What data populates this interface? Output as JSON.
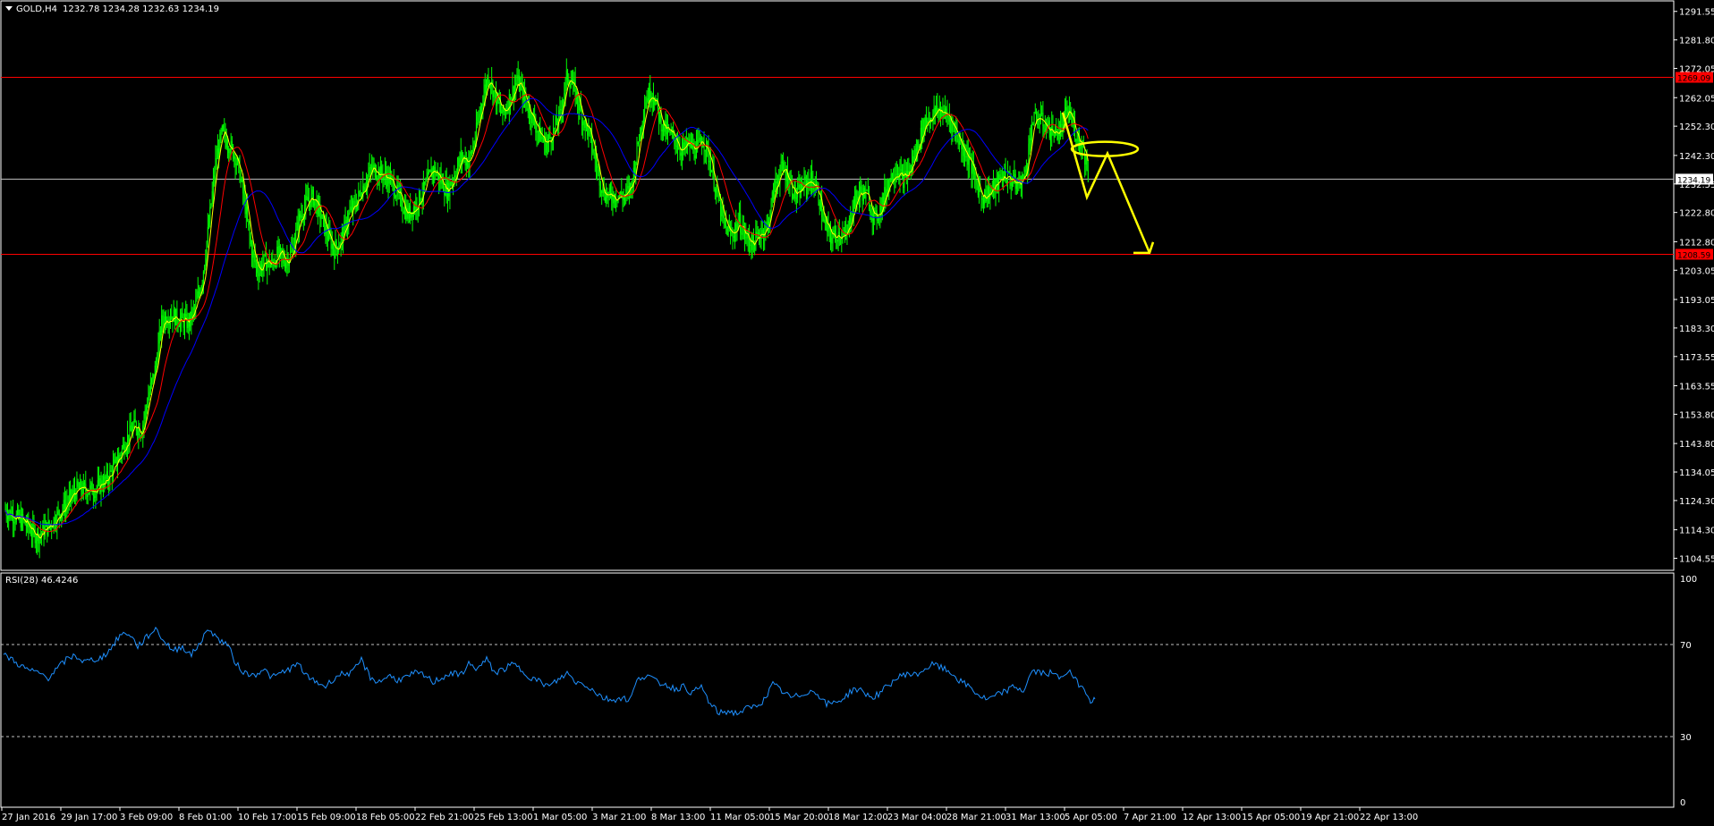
{
  "header": {
    "symbol_label": "GOLD,H4",
    "ohlc_label": "1232.78 1234.28 1232.63 1234.19"
  },
  "rsi_panel": {
    "label": "RSI(28) 46.4246",
    "levels": [
      "100",
      "70",
      "30",
      "0"
    ]
  },
  "colors": {
    "background": "#000000",
    "candles": "#00ff00",
    "ma_fast": "#ffff00",
    "ma_mid": "#ff0000",
    "ma_slow": "#0000ff",
    "horizontal_levels": "#ff0000",
    "current_price_line": "#c0c0c0",
    "rsi_line": "#1e90ff",
    "annotation": "#ffff00",
    "axis_text": "#ffffff"
  },
  "chart_data": [
    {
      "type": "candlestick",
      "title": "",
      "xlabel": "",
      "ylabel": "",
      "ylim": [
        1101.35,
        1293.0
      ],
      "grid": false,
      "y_ticks": [
        "1291.55",
        "1281.80",
        "1272.05",
        "1262.05",
        "1252.30",
        "1242.30",
        "1232.55",
        "1222.80",
        "1212.80",
        "1203.05",
        "1193.05",
        "1183.30",
        "1173.55",
        "1163.55",
        "1153.80",
        "1143.80",
        "1134.05",
        "1124.30",
        "1114.30",
        "1104.55"
      ],
      "x_ticks": [
        "27 Jan 2016",
        "29 Jan 17:00",
        "3 Feb 09:00",
        "8 Feb 01:00",
        "10 Feb 17:00",
        "15 Feb 09:00",
        "18 Feb 05:00",
        "22 Feb 21:00",
        "25 Feb 13:00",
        "1 Mar 05:00",
        "3 Mar 21:00",
        "8 Mar 13:00",
        "11 Mar 05:00",
        "15 Mar 20:00",
        "18 Mar 12:00",
        "23 Mar 04:00",
        "28 Mar 21:00",
        "31 Mar 13:00",
        "5 Apr 05:00",
        "7 Apr 21:00",
        "12 Apr 13:00",
        "15 Apr 05:00",
        "19 Apr 21:00",
        "22 Apr 13:00"
      ],
      "horizontal_lines": [
        {
          "value": 1269.0,
          "label": "1269.09",
          "color": "#ff0000"
        },
        {
          "value": 1234.19,
          "label": "1234.19",
          "color": "#c0c0c0"
        },
        {
          "value": 1208.5,
          "label": "1208.59",
          "color": "#ff0000"
        }
      ],
      "price_path": [
        [
          0,
          1121
        ],
        [
          20,
          1117
        ],
        [
          35,
          1112
        ],
        [
          50,
          1116
        ],
        [
          65,
          1122
        ],
        [
          80,
          1128
        ],
        [
          100,
          1128
        ],
        [
          115,
          1132
        ],
        [
          125,
          1138
        ],
        [
          135,
          1145
        ],
        [
          145,
          1150
        ],
        [
          152,
          1148
        ],
        [
          160,
          1160
        ],
        [
          168,
          1170
        ],
        [
          175,
          1186
        ],
        [
          185,
          1188
        ],
        [
          195,
          1186
        ],
        [
          205,
          1185
        ],
        [
          212,
          1190
        ],
        [
          220,
          1200
        ],
        [
          228,
          1220
        ],
        [
          235,
          1240
        ],
        [
          242,
          1250
        ],
        [
          250,
          1246
        ],
        [
          257,
          1242
        ],
        [
          262,
          1236
        ],
        [
          268,
          1225
        ],
        [
          275,
          1210
        ],
        [
          282,
          1203
        ],
        [
          290,
          1206
        ],
        [
          298,
          1205
        ],
        [
          305,
          1209
        ],
        [
          312,
          1206
        ],
        [
          320,
          1209
        ],
        [
          328,
          1220
        ],
        [
          336,
          1226
        ],
        [
          344,
          1228
        ],
        [
          352,
          1222
        ],
        [
          360,
          1215
        ],
        [
          368,
          1210
        ],
        [
          376,
          1214
        ],
        [
          384,
          1222
        ],
        [
          392,
          1226
        ],
        [
          400,
          1232
        ],
        [
          410,
          1238
        ],
        [
          420,
          1236
        ],
        [
          430,
          1234
        ],
        [
          440,
          1228
        ],
        [
          450,
          1222
        ],
        [
          460,
          1226
        ],
        [
          470,
          1232
        ],
        [
          478,
          1238
        ],
        [
          486,
          1234
        ],
        [
          494,
          1230
        ],
        [
          502,
          1236
        ],
        [
          510,
          1242
        ],
        [
          518,
          1240
        ],
        [
          525,
          1248
        ],
        [
          532,
          1260
        ],
        [
          540,
          1270
        ],
        [
          548,
          1262
        ],
        [
          556,
          1256
        ],
        [
          564,
          1262
        ],
        [
          572,
          1268
        ],
        [
          580,
          1262
        ],
        [
          588,
          1256
        ],
        [
          596,
          1250
        ],
        [
          604,
          1246
        ],
        [
          612,
          1250
        ],
        [
          620,
          1256
        ],
        [
          628,
          1270
        ],
        [
          636,
          1265
        ],
        [
          644,
          1256
        ],
        [
          652,
          1250
        ],
        [
          660,
          1240
        ],
        [
          668,
          1230
        ],
        [
          676,
          1228
        ],
        [
          684,
          1229
        ],
        [
          692,
          1228
        ],
        [
          700,
          1232
        ],
        [
          708,
          1248
        ],
        [
          716,
          1262
        ],
        [
          724,
          1264
        ],
        [
          732,
          1254
        ],
        [
          740,
          1250
        ],
        [
          748,
          1248
        ],
        [
          756,
          1244
        ],
        [
          764,
          1246
        ],
        [
          772,
          1244
        ],
        [
          780,
          1248
        ],
        [
          788,
          1240
        ],
        [
          796,
          1228
        ],
        [
          804,
          1218
        ],
        [
          812,
          1215
        ],
        [
          820,
          1220
        ],
        [
          828,
          1214
        ],
        [
          836,
          1212
        ],
        [
          844,
          1216
        ],
        [
          852,
          1218
        ],
        [
          860,
          1232
        ],
        [
          868,
          1238
        ],
        [
          876,
          1234
        ],
        [
          884,
          1228
        ],
        [
          892,
          1232
        ],
        [
          900,
          1234
        ],
        [
          908,
          1230
        ],
        [
          916,
          1218
        ],
        [
          924,
          1214
        ],
        [
          932,
          1216
        ],
        [
          940,
          1214
        ],
        [
          948,
          1226
        ],
        [
          956,
          1230
        ],
        [
          964,
          1228
        ],
        [
          972,
          1220
        ],
        [
          980,
          1226
        ],
        [
          988,
          1234
        ],
        [
          996,
          1238
        ],
        [
          1004,
          1234
        ],
        [
          1012,
          1238
        ],
        [
          1020,
          1246
        ],
        [
          1028,
          1254
        ],
        [
          1036,
          1256
        ],
        [
          1044,
          1258
        ],
        [
          1052,
          1256
        ],
        [
          1060,
          1252
        ],
        [
          1068,
          1246
        ],
        [
          1076,
          1242
        ],
        [
          1084,
          1234
        ],
        [
          1092,
          1228
        ],
        [
          1100,
          1230
        ],
        [
          1108,
          1232
        ],
        [
          1116,
          1236
        ],
        [
          1124,
          1234
        ],
        [
          1132,
          1232
        ],
        [
          1140,
          1236
        ],
        [
          1148,
          1254
        ],
        [
          1156,
          1255
        ],
        [
          1164,
          1252
        ],
        [
          1172,
          1250
        ],
        [
          1180,
          1251
        ],
        [
          1188,
          1258
        ],
        [
          1196,
          1250
        ],
        [
          1204,
          1246
        ],
        [
          1212,
          1234
        ]
      ],
      "annotations": [
        {
          "type": "arrow-path",
          "color": "#ffff00",
          "points": [
            [
              1188,
              1257
            ],
            [
              1215,
              1228
            ],
            [
              1238,
              1243
            ],
            [
              1285,
              1209
            ]
          ]
        },
        {
          "type": "ellipse",
          "color": "#ffff00",
          "center": [
            1235,
            1244.5
          ]
        }
      ]
    },
    {
      "type": "line",
      "title": "RSI(28) 46.4246",
      "ylim": [
        0,
        100
      ],
      "levels": [
        70,
        30
      ],
      "series": [
        {
          "values": [
            [
              0,
              66
            ],
            [
              10,
              64
            ],
            [
              20,
              61
            ],
            [
              30,
              59
            ],
            [
              40,
              58
            ],
            [
              50,
              56
            ],
            [
              60,
              60
            ],
            [
              70,
              64
            ],
            [
              80,
              66
            ],
            [
              90,
              63
            ],
            [
              100,
              64
            ],
            [
              110,
              65
            ],
            [
              120,
              69
            ],
            [
              130,
              75
            ],
            [
              140,
              76
            ],
            [
              150,
              70
            ],
            [
              160,
              74
            ],
            [
              170,
              78
            ],
            [
              180,
              72
            ],
            [
              190,
              68
            ],
            [
              200,
              70
            ],
            [
              210,
              66
            ],
            [
              220,
              72
            ],
            [
              230,
              78
            ],
            [
              240,
              73
            ],
            [
              250,
              71
            ],
            [
              260,
              62
            ],
            [
              270,
              58
            ],
            [
              280,
              57
            ],
            [
              290,
              60
            ],
            [
              300,
              56
            ],
            [
              310,
              58
            ],
            [
              320,
              60
            ],
            [
              330,
              62
            ],
            [
              340,
              56
            ],
            [
              350,
              54
            ],
            [
              360,
              52
            ],
            [
              370,
              56
            ],
            [
              380,
              58
            ],
            [
              390,
              58
            ],
            [
              400,
              64
            ],
            [
              410,
              56
            ],
            [
              420,
              54
            ],
            [
              430,
              57
            ],
            [
              440,
              55
            ],
            [
              450,
              56
            ],
            [
              460,
              58
            ],
            [
              470,
              57
            ],
            [
              480,
              54
            ],
            [
              490,
              56
            ],
            [
              500,
              58
            ],
            [
              510,
              57
            ],
            [
              520,
              62
            ],
            [
              530,
              60
            ],
            [
              540,
              64
            ],
            [
              550,
              58
            ],
            [
              560,
              60
            ],
            [
              570,
              62
            ],
            [
              580,
              59
            ],
            [
              590,
              56
            ],
            [
              600,
              54
            ],
            [
              610,
              52
            ],
            [
              620,
              55
            ],
            [
              630,
              58
            ],
            [
              640,
              54
            ],
            [
              650,
              53
            ],
            [
              660,
              50
            ],
            [
              670,
              47
            ],
            [
              680,
              46
            ],
            [
              690,
              47
            ],
            [
              700,
              46
            ],
            [
              710,
              56
            ],
            [
              720,
              57
            ],
            [
              730,
              54
            ],
            [
              740,
              53
            ],
            [
              750,
              51
            ],
            [
              760,
              52
            ],
            [
              770,
              49
            ],
            [
              780,
              52
            ],
            [
              790,
              44
            ],
            [
              800,
              40
            ],
            [
              810,
              41
            ],
            [
              820,
              40
            ],
            [
              830,
              42
            ],
            [
              840,
              43
            ],
            [
              850,
              46
            ],
            [
              860,
              53
            ],
            [
              870,
              50
            ],
            [
              880,
              47
            ],
            [
              890,
              48
            ],
            [
              900,
              50
            ],
            [
              910,
              49
            ],
            [
              920,
              44
            ],
            [
              930,
              45
            ],
            [
              940,
              47
            ],
            [
              950,
              51
            ],
            [
              960,
              50
            ],
            [
              970,
              47
            ],
            [
              980,
              49
            ],
            [
              990,
              53
            ],
            [
              1000,
              56
            ],
            [
              1010,
              58
            ],
            [
              1020,
              57
            ],
            [
              1030,
              60
            ],
            [
              1040,
              62
            ],
            [
              1050,
              60
            ],
            [
              1060,
              58
            ],
            [
              1070,
              54
            ],
            [
              1080,
              52
            ],
            [
              1090,
              48
            ],
            [
              1100,
              46
            ],
            [
              1110,
              48
            ],
            [
              1120,
              50
            ],
            [
              1130,
              52
            ],
            [
              1140,
              50
            ],
            [
              1150,
              59
            ],
            [
              1160,
              58
            ],
            [
              1170,
              58
            ],
            [
              1180,
              56
            ],
            [
              1190,
              59
            ],
            [
              1200,
              54
            ],
            [
              1210,
              50
            ],
            [
              1215,
              46
            ],
            [
              1220,
              46.4
            ]
          ]
        }
      ]
    }
  ]
}
